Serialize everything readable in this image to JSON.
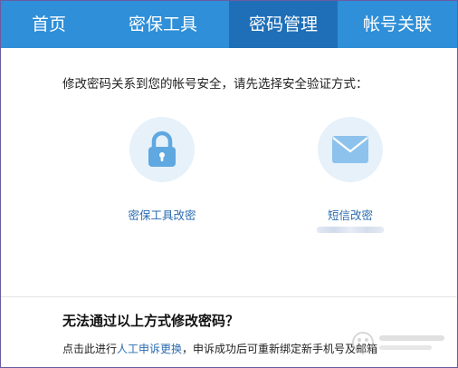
{
  "tabs": [
    {
      "label": "首页"
    },
    {
      "label": "密保工具"
    },
    {
      "label": "密码管理",
      "active": true
    },
    {
      "label": "帐号关联"
    }
  ],
  "intro_text": "修改密码关系到您的帐号安全，请先选择安全验证方式：",
  "options": [
    {
      "label": "密保工具改密",
      "icon": "lock-icon"
    },
    {
      "label": "短信改密",
      "icon": "envelope-icon"
    }
  ],
  "help": {
    "title": "无法通过以上方式修改密码？",
    "prefix": "点击此进行",
    "link": "人工申诉更换",
    "suffix": "，申诉成功后可重新绑定新手机号及邮箱"
  },
  "colors": {
    "tab_bar": "#2f8fd8",
    "tab_active": "#1f6fb8",
    "icon_circle": "#e6f1fa",
    "icon_blue": "#5fa8e0",
    "link": "#2a6bb0"
  }
}
